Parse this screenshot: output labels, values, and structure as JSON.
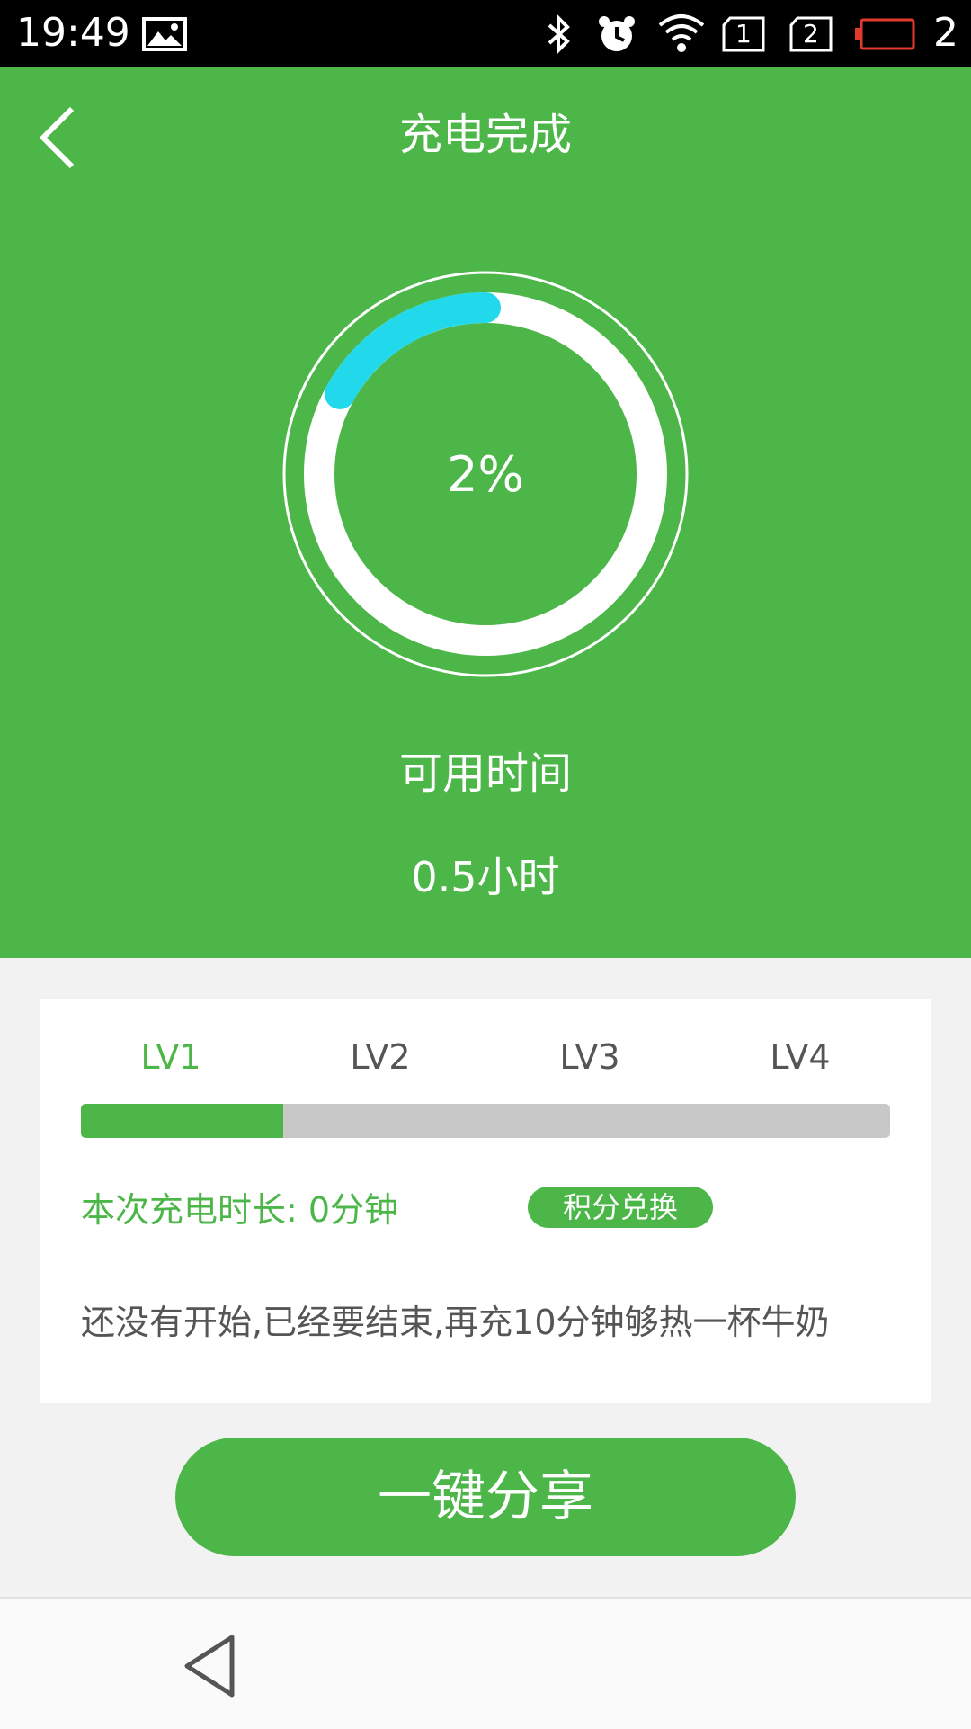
{
  "status_bar": {
    "time": "19:49",
    "sim1": "1",
    "sim2": "2",
    "battery_level": "2",
    "icons": [
      "image-icon",
      "bluetooth-icon",
      "alarm-icon",
      "wifi-icon",
      "sim1-icon",
      "sim2-icon",
      "battery-low-icon"
    ]
  },
  "header": {
    "title": "充电完成",
    "back_icon": "chevron-left-icon"
  },
  "gauge": {
    "percent_text": "2%",
    "arc_fraction": 0.17
  },
  "available": {
    "label": "可用时间",
    "value": "0.5小时"
  },
  "card": {
    "levels": [
      {
        "label": "LV1",
        "active": true
      },
      {
        "label": "LV2",
        "active": false
      },
      {
        "label": "LV3",
        "active": false
      },
      {
        "label": "LV4",
        "active": false
      }
    ],
    "progress_fraction": 0.25,
    "duration_text": "本次充电时长: 0分钟",
    "points_button": "积分兑换",
    "message": "还没有开始,已经要结束,再充10分钟够热一杯牛奶"
  },
  "share_button": "一键分享",
  "colors": {
    "primary_green": "#4cb648",
    "arc_cyan": "#22d9ec",
    "track_gray": "#c8c8c8",
    "battery_red": "#e23b2e"
  }
}
